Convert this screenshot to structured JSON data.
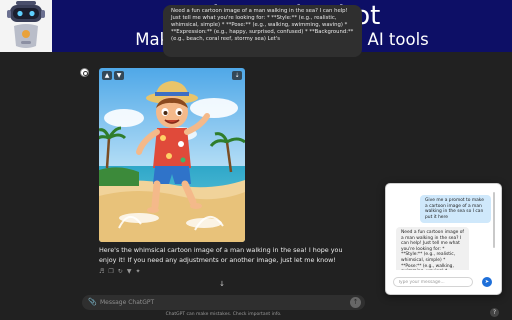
{
  "banner": {
    "title": "Aristos chatbot",
    "subtitle": "Make him write a promot in AI tools",
    "background": "#0d0f66"
  },
  "conversation": {
    "user_message": "Need a fun cartoon image of a man walking in the sea? I can help! Just tell me what you're looking for: * **Style:** (e.g., realistic, whimsical, simple) * **Pose:** (e.g., walking, swimming, waving) * **Expression:** (e.g., happy, surprised, confused) * **Background:** (e.g., beach, coral reef, stormy sea) Let's",
    "assistant_reply": "Here's the whimsical cartoon image of a man walking in the sea! I hope you enjoy it! If you need any adjustments or another image, just let me know!",
    "image_icons": {
      "like": "thumbs-up-icon",
      "dislike": "thumbs-down-icon",
      "download": "download-icon"
    },
    "action_icons": [
      "speaker-icon",
      "copy-icon",
      "regenerate-icon",
      "thumbs-down-icon",
      "model-icon"
    ]
  },
  "composer": {
    "placeholder": "Message ChatGPT",
    "disclaimer": "ChatGPT can make mistakes. Check important info."
  },
  "extension_panel": {
    "user_message": "Give me a promot to make a cartoon image of a man walking in the sea so I can put it here",
    "bot_message": "Need a fun cartoon image of a man walking in the sea? I can help! Just tell me what you're looking for: * **Style:** (e.g., realistic, whimsical, simple) * **Pose:** (e.g., walking, swimming, waving) *",
    "input_placeholder": "Type your message...",
    "accent": "#1e6fd9",
    "user_bubble_color": "#cfe8fb"
  },
  "colors": {
    "chat_background": "#212121",
    "bubble": "#2f2f2f"
  }
}
